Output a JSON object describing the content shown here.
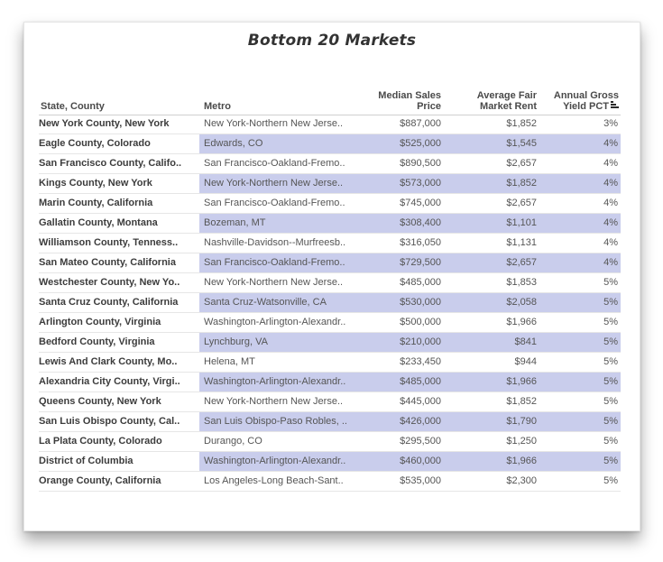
{
  "chart_data": {
    "type": "table",
    "title": "Bottom 20 Markets",
    "columns": [
      "State, County",
      "Metro",
      "Median Sales\nPrice",
      "Average Fair\nMarket Rent",
      "Annual Gross\nYield PCT"
    ],
    "header": {
      "state": "State, County",
      "metro": "Metro",
      "price_line1": "Median Sales",
      "price_line2": "Price",
      "rent_line1": "Average Fair",
      "rent_line2": "Market Rent",
      "yield_line1": "Annual Gross",
      "yield_line2": "Yield PCT"
    },
    "rows": [
      {
        "state": "New York County, New York",
        "metro": "New York-Northern New Jerse..",
        "price": "$887,000",
        "rent": "$1,852",
        "yield": "3%",
        "highlight": false
      },
      {
        "state": "Eagle County, Colorado",
        "metro": "Edwards, CO",
        "price": "$525,000",
        "rent": "$1,545",
        "yield": "4%",
        "highlight": true
      },
      {
        "state": "San Francisco County, Califo..",
        "metro": "San Francisco-Oakland-Fremo..",
        "price": "$890,500",
        "rent": "$2,657",
        "yield": "4%",
        "highlight": false
      },
      {
        "state": "Kings County, New York",
        "metro": "New York-Northern New Jerse..",
        "price": "$573,000",
        "rent": "$1,852",
        "yield": "4%",
        "highlight": true
      },
      {
        "state": "Marin County, California",
        "metro": "San Francisco-Oakland-Fremo..",
        "price": "$745,000",
        "rent": "$2,657",
        "yield": "4%",
        "highlight": false
      },
      {
        "state": "Gallatin County, Montana",
        "metro": "Bozeman, MT",
        "price": "$308,400",
        "rent": "$1,101",
        "yield": "4%",
        "highlight": true
      },
      {
        "state": "Williamson County, Tenness..",
        "metro": "Nashville-Davidson--Murfreesb..",
        "price": "$316,050",
        "rent": "$1,131",
        "yield": "4%",
        "highlight": false
      },
      {
        "state": "San Mateo County, California",
        "metro": "San Francisco-Oakland-Fremo..",
        "price": "$729,500",
        "rent": "$2,657",
        "yield": "4%",
        "highlight": true
      },
      {
        "state": "Westchester County, New Yo..",
        "metro": "New York-Northern New Jerse..",
        "price": "$485,000",
        "rent": "$1,853",
        "yield": "5%",
        "highlight": false
      },
      {
        "state": "Santa Cruz County, California",
        "metro": "Santa Cruz-Watsonville, CA",
        "price": "$530,000",
        "rent": "$2,058",
        "yield": "5%",
        "highlight": true
      },
      {
        "state": "Arlington County, Virginia",
        "metro": "Washington-Arlington-Alexandr..",
        "price": "$500,000",
        "rent": "$1,966",
        "yield": "5%",
        "highlight": false
      },
      {
        "state": "Bedford County, Virginia",
        "metro": "Lynchburg, VA",
        "price": "$210,000",
        "rent": "$841",
        "yield": "5%",
        "highlight": true
      },
      {
        "state": "Lewis And Clark County, Mo..",
        "metro": "Helena, MT",
        "price": "$233,450",
        "rent": "$944",
        "yield": "5%",
        "highlight": false
      },
      {
        "state": "Alexandria City County, Virgi..",
        "metro": "Washington-Arlington-Alexandr..",
        "price": "$485,000",
        "rent": "$1,966",
        "yield": "5%",
        "highlight": true
      },
      {
        "state": "Queens County, New York",
        "metro": "New York-Northern New Jerse..",
        "price": "$445,000",
        "rent": "$1,852",
        "yield": "5%",
        "highlight": false
      },
      {
        "state": "San Luis Obispo County, Cal..",
        "metro": "San Luis Obispo-Paso Robles, ..",
        "price": "$426,000",
        "rent": "$1,790",
        "yield": "5%",
        "highlight": true
      },
      {
        "state": "La Plata County, Colorado",
        "metro": "Durango, CO",
        "price": "$295,500",
        "rent": "$1,250",
        "yield": "5%",
        "highlight": false
      },
      {
        "state": "District of Columbia",
        "metro": "Washington-Arlington-Alexandr..",
        "price": "$460,000",
        "rent": "$1,966",
        "yield": "5%",
        "highlight": true
      },
      {
        "state": "Orange County, California",
        "metro": "Los Angeles-Long Beach-Sant..",
        "price": "$535,000",
        "rent": "$2,300",
        "yield": "5%",
        "highlight": false
      }
    ],
    "highlight_color": "#c9cdec",
    "sort_icon": "sort-descending-icon"
  }
}
